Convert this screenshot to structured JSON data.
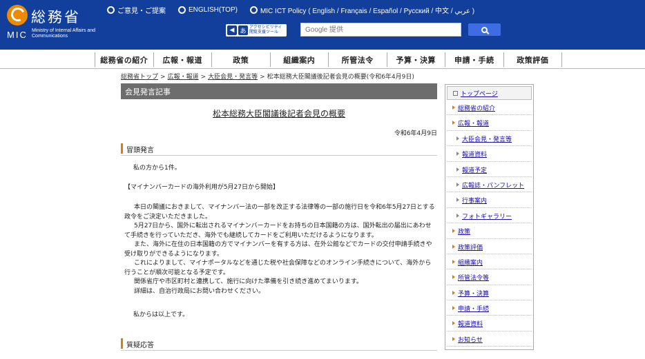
{
  "header": {
    "logo_jp": "総務省",
    "logo_mic": "MIC",
    "logo_en": "Ministry of Internal Affairs and Communications",
    "links": [
      {
        "label": "ご意見・ご提案"
      },
      {
        "label": "ENGLISH(TOP)"
      },
      {
        "label": "MIC ICT Policy ( English / Français / Español / Русский / 中文 / عربي )"
      }
    ],
    "a11y_badge": "あ",
    "a11y_text_1": "アクセシビリティ",
    "a11y_text_2": "閲覧支援ツール",
    "search_placeholder": "Google 提供"
  },
  "nav": {
    "items": [
      "総務省の紹介",
      "広報・報道",
      "政策",
      "組織案内",
      "所管法令",
      "予算・決算",
      "申請・手続",
      "政策評価"
    ]
  },
  "breadcrumb": {
    "items": [
      "総務省トップ",
      "広報・報道",
      "大臣会見・発言等"
    ],
    "current": "松本総務大臣閣議後記者会見の概要(令和6年4月9日)",
    "sep": ">"
  },
  "main": {
    "section_title": "会見発言記事",
    "page_title": "松本総務大臣閣議後記者会見の概要",
    "date": "令和6年4月9日",
    "h_opening": "冒頭発言",
    "intro": "私の方から1件。",
    "topic": "【マイナンバーカードの海外利用が5月27日から開始】",
    "paragraphs": [
      "本日の閣議におきまして、マイナンバー法の一部を改正する法律等の一部の施行日を令和6年5月27日とする政令をご決定いただきました。",
      "5月27日から、国外に転出されるマイナンバーカードをお持ちの日本国籍の方は、国外転出の届出にあわせて手続きを行っていただき、海外でも継続してカードをご利用いただけるようになります。",
      "また、海外に在住の日本国籍の方でマイナンバーを有する方は、在外公館などでカードの交付申請手続きや受け取りができるようになります。",
      "これによりまして、マイナポータルなどを通じた税や社会保障などのオンライン手続きについて、海外から行うことが順次可能となる予定です。",
      "関係省庁や市区町村と連携して、施行に向けた準備を引き続き進めてまいります。",
      "詳細は、自治行政局にお問い合わせください。"
    ],
    "closing": "私からは以上です。",
    "h_qa": "質疑応答"
  },
  "sidebar": {
    "top": "トップページ",
    "items": [
      {
        "label": "総務省の紹介",
        "level": 1
      },
      {
        "label": "広報・報道",
        "level": 1
      },
      {
        "label": "大臣会見・発言等",
        "level": 2
      },
      {
        "label": "報道資料",
        "level": 2
      },
      {
        "label": "報道予定",
        "level": 2
      },
      {
        "label": "広報誌・パンフレット",
        "level": 2
      },
      {
        "label": "行事案内",
        "level": 2
      },
      {
        "label": "フォトギャラリー",
        "level": 2
      },
      {
        "label": "政策",
        "level": 1
      },
      {
        "label": "政策評価",
        "level": 1
      },
      {
        "label": "組織案内",
        "level": 1
      },
      {
        "label": "所管法令等",
        "level": 1
      },
      {
        "label": "予算・決算",
        "level": 1
      },
      {
        "label": "申請・手続",
        "level": 1
      },
      {
        "label": "報道資料",
        "level": 1
      },
      {
        "label": "お知らせ",
        "level": 1
      }
    ]
  }
}
